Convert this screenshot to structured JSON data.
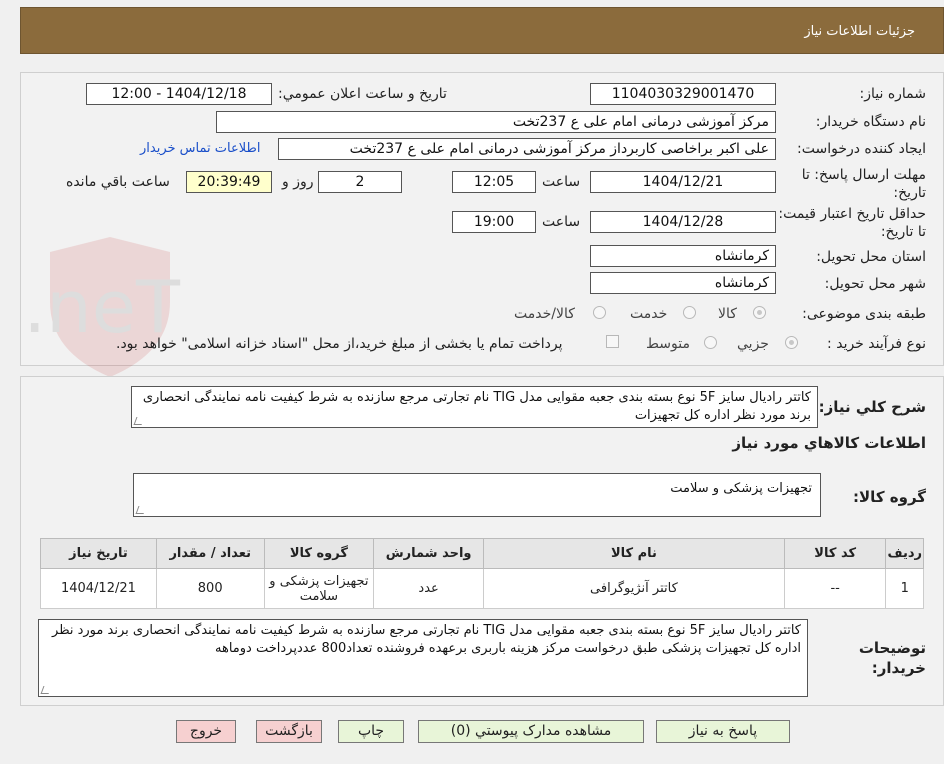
{
  "header": {
    "title": "جزئیات اطلاعات نیاز"
  },
  "watermark": {
    "brand": "AriaTender.neT"
  },
  "form": {
    "need_number": {
      "label": "شماره نیاز:",
      "value": "1104030329001470"
    },
    "announce_datetime": {
      "label": "تاریخ و ساعت اعلان عمومي:",
      "value": "1404/12/18 - 12:00"
    },
    "buyer_org": {
      "label": "نام دستگاه خریدار:",
      "value": "مرکز آموزشی درمانی امام علی ع 237تخت"
    },
    "requester": {
      "label": "ایجاد کننده درخواست:",
      "value": "علی اکبر براخاصی کاربرداز  مرکز آموزشی درمانی امام علی ع 237تخت",
      "contact_link": "اطلاعات تماس خریدار"
    },
    "response_deadline": {
      "label": "مهلت ارسال پاسخ: تا تاریخ:",
      "date": "1404/12/21",
      "time_label": "ساعت",
      "time": "12:05",
      "days": "2",
      "days_label": "روز و",
      "remaining": "20:39:49",
      "remaining_label": "ساعت باقي مانده"
    },
    "price_validity": {
      "label": "حداقل تاریخ اعتبار قیمت: تا تاریخ:",
      "date": "1404/12/28",
      "time_label": "ساعت",
      "time": "19:00"
    },
    "delivery_province": {
      "label": "استان محل تحویل:",
      "value": "کرمانشاه"
    },
    "delivery_city": {
      "label": "شهر محل تحویل:",
      "value": "کرمانشاه"
    },
    "category": {
      "label": "طبقه بندی موضوعی:",
      "options": [
        "کالا",
        "خدمت",
        "کالا/خدمت"
      ]
    },
    "process_type": {
      "label": "نوع فرآیند خرید :",
      "options": [
        "جزیي",
        "متوسط"
      ],
      "note": "پرداخت تمام یا بخشی از مبلغ خرید،از محل \"اسناد خزانه اسلامی\" خواهد بود."
    }
  },
  "summary": {
    "label": "شرح کلي نیاز:",
    "text": "کاتتر رادیال سایز 5F نوع بسته بندی جعبه مقوایی مدل TIG نام تجارتی  مرجع سازنده   به شرط کیفیت نامه نمایندگی انحصاری برند مورد نظر اداره کل تجهیزات"
  },
  "goods_section": {
    "title": "اطلاعات کالاهاي مورد نیاز"
  },
  "goods_group": {
    "label": "گروه کالا:",
    "value": "تجهیزات پزشکی و سلامت"
  },
  "table": {
    "headers": [
      "ردیف",
      "کد کالا",
      "نام کالا",
      "واحد شمارش",
      "گروه کالا",
      "تعداد / مقدار",
      "تاریخ نیاز"
    ],
    "rows": [
      [
        "1",
        "--",
        "کاتتر آنژیوگرافی",
        "عدد",
        "تجهیزات پزشکی و سلامت",
        "800",
        "1404/12/21"
      ]
    ]
  },
  "buyer_notes": {
    "label": "توضیحات خریدار:",
    "text": "کاتتر رادیال سایز 5F نوع بسته بندی جعبه مقوایی مدل TIG نام تجارتی  مرجع سازنده   به شرط کیفیت نامه نمایندگی انحصاری برند مورد نظر اداره کل تجهیزات پزشکی طبق درخواست مرکز هزینه باربری برعهده فروشنده تعداد800 عددپرداخت دوماهه"
  },
  "buttons": {
    "respond": "پاسخ به نیاز",
    "attachments": "مشاهده مدارک پیوستي (0)",
    "print": "چاپ",
    "back": "بازگشت",
    "exit": "خروج"
  }
}
